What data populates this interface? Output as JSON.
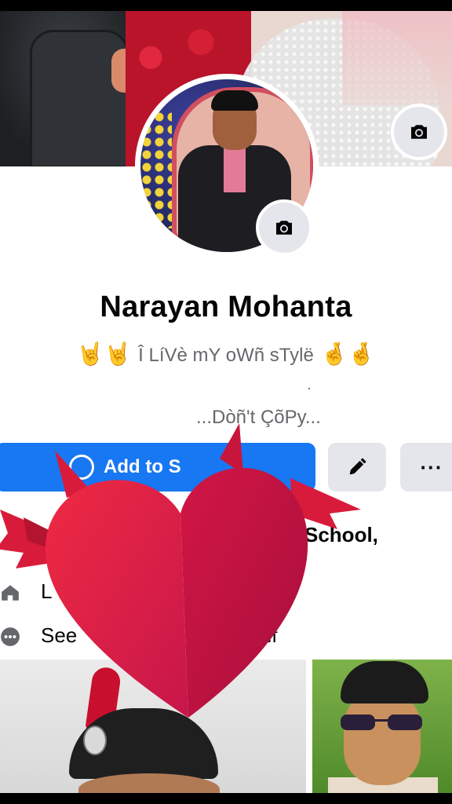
{
  "profile": {
    "name": "Narayan Mohanta",
    "bio_line1": "Î LíVè mY oWñ sTylë",
    "bio_line1_emoji_left": "🤘🤘",
    "bio_line1_emoji_right": "🤞🤞",
    "bio_line2": ".",
    "bio_line3": "...Dòñ't ÇõPy..."
  },
  "actions": {
    "add_label": "Add to S",
    "edit_icon": "pencil-icon",
    "more_label": "···"
  },
  "details": {
    "school_text": "School,",
    "live_text": "L",
    "see_text": "See",
    "see_suffix": "elf"
  },
  "icons": {
    "cover_camera": "camera-icon",
    "avatar_camera": "camera-icon",
    "home": "home-icon",
    "more": "more-icon"
  },
  "colors": {
    "accent": "#1877f2",
    "sticker_red": "#e0213f"
  }
}
